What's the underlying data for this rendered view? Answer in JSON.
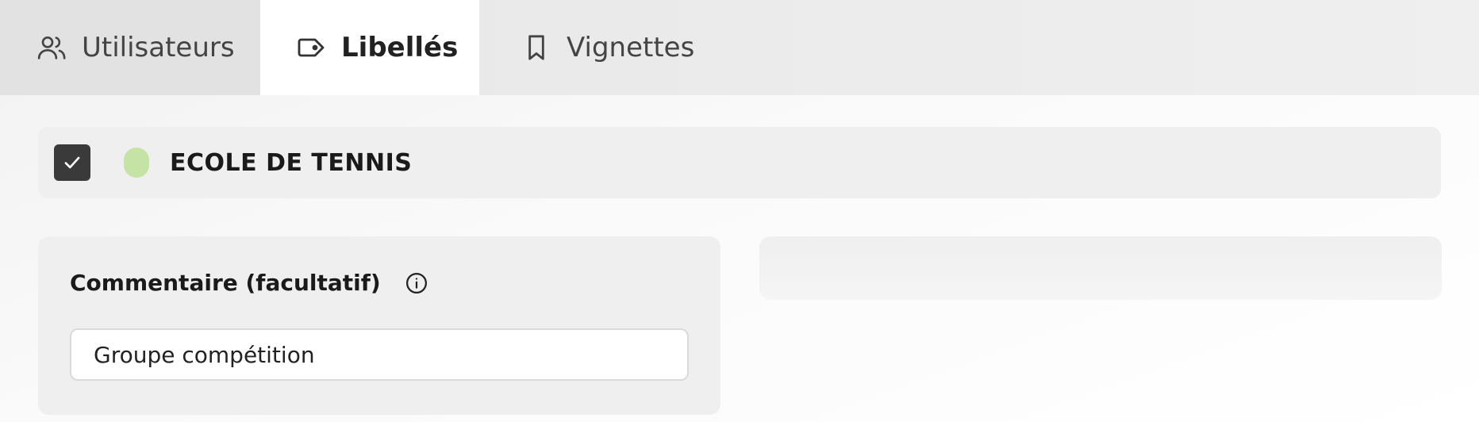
{
  "tabs": [
    {
      "label": "Utilisateurs",
      "icon": "users-icon",
      "active": false
    },
    {
      "label": "Libellés",
      "icon": "tag-icon",
      "active": true
    },
    {
      "label": "Vignettes",
      "icon": "bookmark-icon",
      "active": false
    }
  ],
  "tag": {
    "checked": true,
    "color": "#c5e3a4",
    "name": "ECOLE DE TENNIS"
  },
  "comment": {
    "title": "Commentaire (facultatif)",
    "info_icon": "info-icon",
    "value": "Groupe compétition"
  },
  "colors": {
    "checkbox_bg": "#3a3a3a",
    "tab_active_bg": "#ffffff",
    "tab_inactive_bg": "#e6e6e6"
  }
}
